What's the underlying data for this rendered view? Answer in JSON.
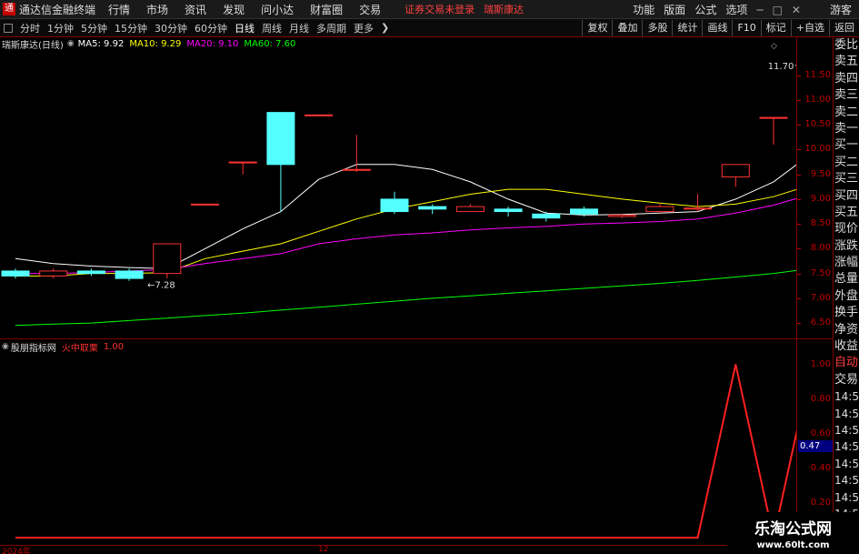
{
  "menubar": {
    "app_title": "通达信金融终端",
    "items": [
      "行情",
      "市场",
      "资讯",
      "发现",
      "问小达",
      "财富圈",
      "交易"
    ],
    "notice": "证券交易未登录",
    "notice_stock": "瑞斯康达",
    "right_items": [
      "功能",
      "版面",
      "公式",
      "选项"
    ],
    "guest": "游客",
    "logo_letter": "通",
    "min_glyph": "─",
    "max_glyph": "□",
    "close_glyph": "✕"
  },
  "periodbar": {
    "periods": [
      "分时",
      "1分钟",
      "5分钟",
      "15分钟",
      "30分钟",
      "60分钟",
      "日线",
      "周线",
      "月线",
      "多周期",
      "更多"
    ],
    "active": "日线",
    "more_glyph": "❯",
    "right_buttons": [
      "复权",
      "叠加",
      "多股",
      "统计",
      "画线",
      "F10",
      "标记",
      "+自选",
      "返回"
    ]
  },
  "chart": {
    "stock_label": "瑞斯康达(日线)",
    "ma": [
      {
        "label": "MA5: 9.92",
        "color": "#ffffff"
      },
      {
        "label": "MA10: 9.29",
        "color": "#ffff00"
      },
      {
        "label": "MA20: 9.10",
        "color": "#ff00ff"
      },
      {
        "label": "MA60: 7.60",
        "color": "#00ff00"
      }
    ],
    "price_ticks": [
      "11.50",
      "11.00",
      "10.50",
      "10.00",
      "9.50",
      "9.00",
      "8.50",
      "8.00",
      "7.50",
      "7.00",
      "6.50"
    ],
    "high_label": "11.70",
    "low_label": "7.28",
    "date_labels": [
      "2024年",
      "12"
    ],
    "colors": {
      "up": "#ff3232",
      "down": "#54ffff",
      "grid": "#800000"
    }
  },
  "indicator": {
    "name": "股朋指标网",
    "series_label": "火中取栗",
    "series_value": "1.00",
    "ticks": [
      "1.00",
      "0.80",
      "0.60",
      "0.40",
      "0.20"
    ],
    "cursor_value": "0.47",
    "color": "#ff2020"
  },
  "side_panel": {
    "labels": [
      "委比",
      "卖五",
      "卖四",
      "卖三",
      "卖二",
      "卖一",
      "买一",
      "买二",
      "买三",
      "买四",
      "买五",
      "现价",
      "涨跌",
      "涨幅",
      "总量",
      "外盘",
      "换手",
      "净资",
      "收益",
      "自动",
      "交易",
      "14:56",
      "14:56",
      "14:56",
      "14:56",
      "14:56",
      "14:56",
      "14:56",
      "14:56",
      "14:56"
    ],
    "corner": "R"
  },
  "watermark": {
    "line1": "乐淘公式网",
    "line2": "www.60lt.com"
  },
  "chart_data": {
    "type": "candlestick",
    "candles": [
      {
        "o": 7.55,
        "c": 7.45,
        "h": 7.6,
        "l": 7.4
      },
      {
        "o": 7.45,
        "c": 7.55,
        "h": 7.6,
        "l": 7.4
      },
      {
        "o": 7.55,
        "c": 7.5,
        "h": 7.6,
        "l": 7.45
      },
      {
        "o": 7.55,
        "c": 7.4,
        "h": 7.6,
        "l": 7.35
      },
      {
        "o": 7.5,
        "c": 8.1,
        "h": 8.1,
        "l": 7.4
      },
      {
        "o": 8.9,
        "c": 8.9,
        "h": 8.9,
        "l": 8.9
      },
      {
        "o": 9.75,
        "c": 9.75,
        "h": 9.75,
        "l": 9.5
      },
      {
        "o": 10.75,
        "c": 9.7,
        "h": 10.75,
        "l": 8.75
      },
      {
        "o": 10.7,
        "c": 10.7,
        "h": 10.7,
        "l": 10.7
      },
      {
        "o": 9.6,
        "c": 9.6,
        "h": 10.3,
        "l": 9.55
      },
      {
        "o": 9.0,
        "c": 8.75,
        "h": 9.15,
        "l": 8.7
      },
      {
        "o": 8.85,
        "c": 8.8,
        "h": 8.9,
        "l": 8.7
      },
      {
        "o": 8.75,
        "c": 8.85,
        "h": 8.9,
        "l": 8.75
      },
      {
        "o": 8.8,
        "c": 8.75,
        "h": 8.85,
        "l": 8.65
      },
      {
        "o": 8.7,
        "c": 8.62,
        "h": 8.75,
        "l": 8.55
      },
      {
        "o": 8.8,
        "c": 8.7,
        "h": 8.85,
        "l": 8.65
      },
      {
        "o": 8.65,
        "c": 8.68,
        "h": 8.7,
        "l": 8.62
      },
      {
        "o": 8.75,
        "c": 8.85,
        "h": 8.9,
        "l": 8.72
      },
      {
        "o": 8.8,
        "c": 8.82,
        "h": 9.1,
        "l": 8.75
      },
      {
        "o": 9.45,
        "c": 9.7,
        "h": 9.7,
        "l": 9.25
      },
      {
        "o": 10.65,
        "c": 10.65,
        "h": 10.65,
        "l": 10.1
      },
      {
        "o": 11.3,
        "c": 11.7,
        "h": 11.7,
        "l": 11.05
      }
    ],
    "ma_series": [
      {
        "name": "MA5",
        "values": [
          7.8,
          7.7,
          7.65,
          7.62,
          7.6,
          8.0,
          8.4,
          8.75,
          9.4,
          9.7,
          9.7,
          9.6,
          9.35,
          9.0,
          8.72,
          8.68,
          8.69,
          8.72,
          8.75,
          9.0,
          9.35,
          9.92
        ]
      },
      {
        "name": "MA10",
        "values": [
          7.45,
          7.45,
          7.5,
          7.5,
          7.52,
          7.8,
          7.95,
          8.1,
          8.35,
          8.6,
          8.8,
          8.95,
          9.1,
          9.2,
          9.2,
          9.1,
          9.0,
          8.92,
          8.85,
          8.9,
          9.05,
          9.29
        ]
      },
      {
        "name": "MA20",
        "values": [
          7.5,
          7.5,
          7.52,
          7.55,
          7.58,
          7.7,
          7.8,
          7.9,
          8.1,
          8.2,
          8.28,
          8.32,
          8.38,
          8.42,
          8.45,
          8.5,
          8.52,
          8.55,
          8.6,
          8.72,
          8.88,
          9.1
        ]
      },
      {
        "name": "MA60",
        "values": [
          6.45,
          6.48,
          6.5,
          6.55,
          6.6,
          6.65,
          6.7,
          6.76,
          6.82,
          6.88,
          6.94,
          7.0,
          7.05,
          7.1,
          7.15,
          7.2,
          7.25,
          7.3,
          7.36,
          7.43,
          7.5,
          7.6
        ]
      }
    ],
    "indicator_series": {
      "name": "火中取栗",
      "values": [
        0,
        0,
        0,
        0,
        0,
        0,
        0,
        0,
        0,
        0,
        0,
        0,
        0,
        0,
        0,
        0,
        0,
        0,
        0,
        1,
        0,
        1
      ]
    },
    "ylim": [
      6.3,
      11.9
    ],
    "ylim_indicator": [
      0,
      1.05
    ]
  }
}
